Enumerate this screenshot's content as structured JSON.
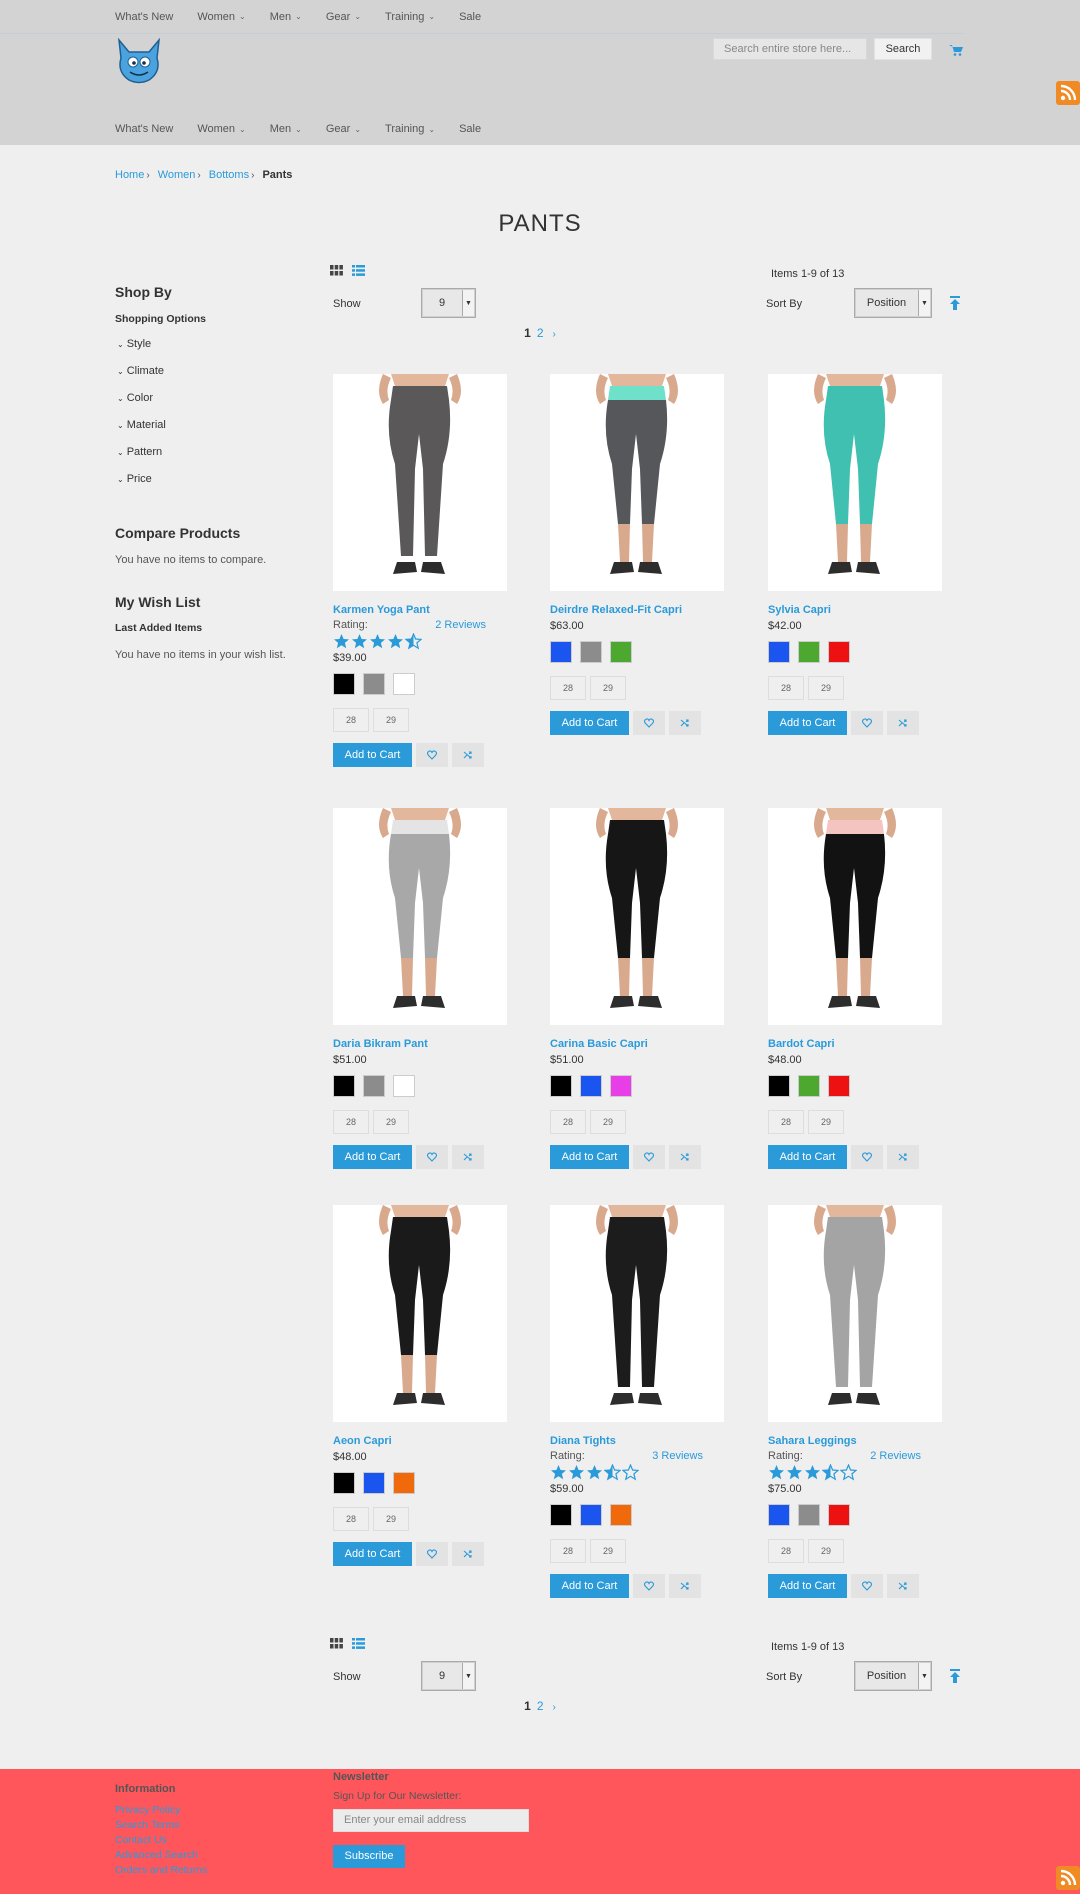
{
  "nav": {
    "items": [
      {
        "label": "What's New",
        "caret": false
      },
      {
        "label": "Women",
        "caret": true
      },
      {
        "label": "Men",
        "caret": true
      },
      {
        "label": "Gear",
        "caret": true
      },
      {
        "label": "Training",
        "caret": true
      },
      {
        "label": "Sale",
        "caret": false
      }
    ],
    "caret_glyph": "⌄"
  },
  "search": {
    "placeholder": "Search entire store here...",
    "button_label": "Search"
  },
  "breadcrumb": {
    "home": "Home",
    "women": "Women",
    "bottoms": "Bottoms",
    "current": "Pants",
    "separator": "›"
  },
  "page_title": "PANTS",
  "sidebar": {
    "shop_by": "Shop By",
    "shopping_options": "Shopping Options",
    "filters": [
      "Style",
      "Climate",
      "Color",
      "Material",
      "Pattern",
      "Price"
    ],
    "compare_title": "Compare Products",
    "compare_text": "You have no items to compare.",
    "wishlist_title": "My Wish List",
    "wishlist_sub": "Last Added Items",
    "wishlist_text": "You have no items in your wish list."
  },
  "toolbar": {
    "items_count": "Items 1-9 of 13",
    "show_label": "Show",
    "show_value": "9",
    "sort_label": "Sort By",
    "sort_value": "Position",
    "page_current": "1",
    "page_next": "2",
    "next_glyph": "›"
  },
  "colors": {
    "accent": "#2a9ad9",
    "star": "#2a9ad9",
    "footer_bg": "#ff565b",
    "rss": "#f08a24"
  },
  "products": [
    {
      "name": "Karmen Yoga Pant",
      "rating_label": "Rating:",
      "reviews": "2 Reviews",
      "stars": 4.5,
      "price": "$39.00",
      "swatches": [
        "#000000",
        "#8c8c8c",
        "#ffffff"
      ],
      "sizes": [
        "28",
        "29"
      ],
      "pants": "#5a5858",
      "waist": "#5a5858",
      "cut": "full"
    },
    {
      "name": "Deirdre Relaxed-Fit Capri",
      "rating_label": "",
      "reviews": "",
      "stars": 0,
      "price": "$63.00",
      "swatches": [
        "#1a55f0",
        "#8c8c8c",
        "#4ca82e"
      ],
      "sizes": [
        "28",
        "29"
      ],
      "pants": "#55575a",
      "waist": "#6fe0c9",
      "cut": "capri"
    },
    {
      "name": "Sylvia Capri",
      "rating_label": "",
      "reviews": "",
      "stars": 0,
      "price": "$42.00",
      "swatches": [
        "#1a55f0",
        "#4ca82e",
        "#ee1111"
      ],
      "sizes": [
        "28",
        "29"
      ],
      "pants": "#3fc0b0",
      "waist": "#3fc0b0",
      "cut": "capri"
    },
    {
      "name": "Daria Bikram Pant",
      "rating_label": "",
      "reviews": "",
      "stars": 0,
      "price": "$51.00",
      "swatches": [
        "#000000",
        "#8c8c8c",
        "#ffffff"
      ],
      "sizes": [
        "28",
        "29"
      ],
      "pants": "#a8a8a8",
      "waist": "#e4e4e4",
      "cut": "capri"
    },
    {
      "name": "Carina Basic Capri",
      "rating_label": "",
      "reviews": "",
      "stars": 0,
      "price": "$51.00",
      "swatches": [
        "#000000",
        "#1a55f0",
        "#e83ee8"
      ],
      "sizes": [
        "28",
        "29"
      ],
      "pants": "#161616",
      "waist": "#161616",
      "cut": "capri"
    },
    {
      "name": "Bardot Capri",
      "rating_label": "",
      "reviews": "",
      "stars": 0,
      "price": "$48.00",
      "swatches": [
        "#000000",
        "#4ca82e",
        "#ee1111"
      ],
      "sizes": [
        "28",
        "29"
      ],
      "pants": "#121212",
      "waist": "#f4c4c0",
      "cut": "capri"
    },
    {
      "name": "Aeon Capri",
      "rating_label": "",
      "reviews": "",
      "stars": 0,
      "price": "$48.00",
      "swatches": [
        "#000000",
        "#1a55f0",
        "#f06a0c"
      ],
      "sizes": [
        "28",
        "29"
      ],
      "pants": "#1a1a1a",
      "waist": "#1a1a1a",
      "cut": "capri"
    },
    {
      "name": "Diana Tights",
      "rating_label": "Rating:",
      "reviews": "3 Reviews",
      "stars": 3.5,
      "price": "$59.00",
      "swatches": [
        "#000000",
        "#1a55f0",
        "#f06a0c"
      ],
      "sizes": [
        "28",
        "29"
      ],
      "pants": "#1c1c1c",
      "waist": "#1c1c1c",
      "cut": "full"
    },
    {
      "name": "Sahara Leggings",
      "rating_label": "Rating:",
      "reviews": "2 Reviews",
      "stars": 3.5,
      "price": "$75.00",
      "swatches": [
        "#1a55f0",
        "#8c8c8c",
        "#ee1111"
      ],
      "sizes": [
        "28",
        "29"
      ],
      "pants": "#a4a4a4",
      "waist": "#a4a4a4",
      "cut": "full"
    }
  ],
  "product_buttons": {
    "add_to_cart": "Add to Cart"
  },
  "footer": {
    "info_title": "Information",
    "links": [
      "Privacy Policy",
      "Search Terms",
      "Contact Us",
      "Advanced Search",
      "Orders and Returns"
    ],
    "newsletter_title": "Newsletter",
    "newsletter_sub": "Sign Up for Our Newsletter:",
    "email_placeholder": "Enter your email address",
    "subscribe": "Subscribe"
  }
}
